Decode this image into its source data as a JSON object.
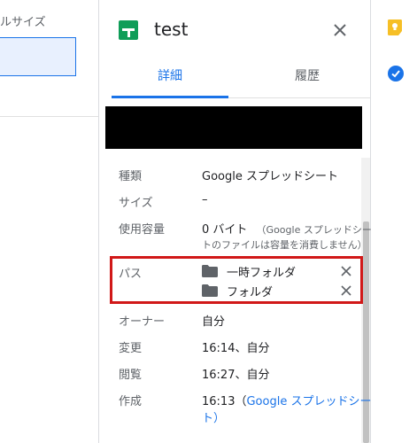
{
  "background": {
    "left_label": "ルサイズ"
  },
  "panel": {
    "title": "test",
    "tabs": [
      {
        "label": "詳細",
        "active": true
      },
      {
        "label": "履歴",
        "active": false
      }
    ],
    "properties": {
      "type": {
        "label": "種類",
        "value": "Google スプレッドシート"
      },
      "size": {
        "label": "サイズ",
        "value": "–"
      },
      "storage": {
        "label": "使用容量",
        "value": "0 バイト",
        "note_line1": "（Google スプレッドシー",
        "note_line2": "トのファイルは容量を消費しません）"
      },
      "path": {
        "label": "パス",
        "folders": [
          "一時フォルダ",
          "フォルダ"
        ]
      },
      "owner": {
        "label": "オーナー",
        "value": "自分"
      },
      "modified": {
        "label": "変更",
        "value": "16:14、自分"
      },
      "viewed": {
        "label": "閲覧",
        "value": "16:27、自分"
      },
      "created": {
        "label": "作成",
        "value": "16:13（",
        "link_text": "Google スプレッドシー",
        "value_line2": "ト）"
      }
    }
  },
  "colors": {
    "accent": "#1a73e8",
    "highlight": "#d11818",
    "sheets_green": "#0f9d58",
    "keep_yellow": "#f6bf26"
  },
  "icons": [
    "sheets-icon",
    "close-icon",
    "folder-icon",
    "remove-icon",
    "keep-icon",
    "tasks-icon"
  ]
}
